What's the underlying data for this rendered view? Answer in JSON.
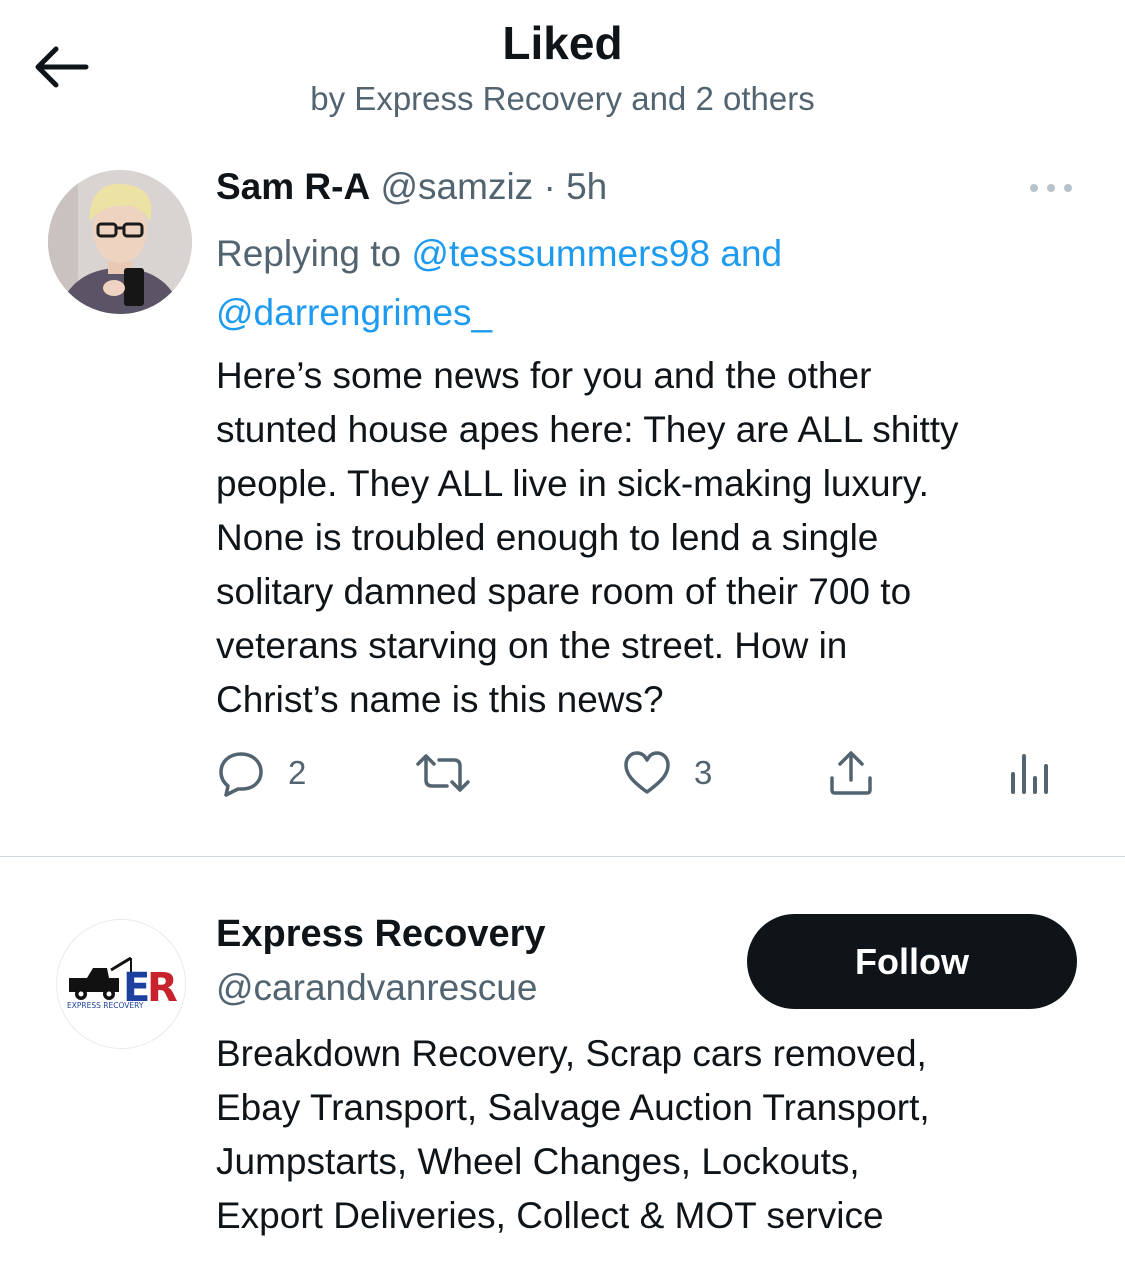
{
  "header": {
    "title": "Liked",
    "subtitle": "by Express Recovery and 2 others"
  },
  "tweet": {
    "display_name": "Sam R-A",
    "handle": "@samziz",
    "separator": "·",
    "time": "5h",
    "replying_prefix": "Replying to",
    "mention_1": "@tesssummers98",
    "mention_joiner": "and",
    "mention_2": "@darrengrimes_",
    "body_lines": [
      "Here’s some news for you and the other",
      "stunted house apes here: They are ALL shitty",
      "people. They ALL live in sick-making luxury.",
      "None is troubled enough to lend a single",
      "solitary damned spare room of their 700 to",
      "veterans starving on the street. How in",
      "Christ’s name is this news?"
    ],
    "reply_count": "2",
    "like_count": "3"
  },
  "user": {
    "display_name": "Express Recovery",
    "handle": "@carandvanrescue",
    "follow_label": "Follow",
    "logo_initials": "ER",
    "logo_caption": "EXPRESS RECOVERY",
    "bio_lines": [
      "Breakdown Recovery, Scrap cars removed,",
      "Ebay Transport, Salvage Auction Transport,",
      "Jumpstarts, Wheel Changes, Lockouts,",
      "Export Deliveries, Collect & MOT service"
    ]
  },
  "colors": {
    "accent": "#1d9bf0",
    "text": "#0f1419",
    "muted": "#536471",
    "divider": "#cfd9de",
    "button_bg": "#0f1419"
  },
  "icons": [
    "back-arrow-icon",
    "more-icon",
    "reply-icon",
    "retweet-icon",
    "like-icon",
    "share-icon",
    "analytics-icon"
  ]
}
